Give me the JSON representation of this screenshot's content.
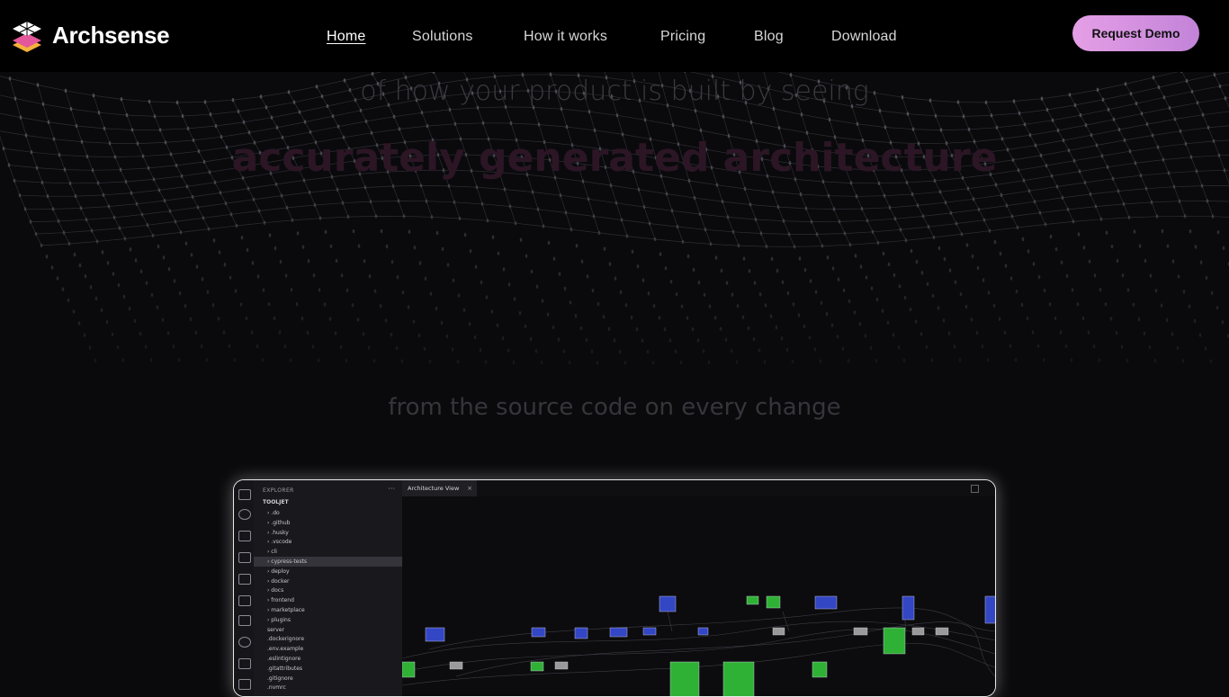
{
  "header": {
    "brand": "Archsense",
    "nav": [
      {
        "label": "Home",
        "active": true
      },
      {
        "label": "Solutions"
      },
      {
        "label": "How it works"
      },
      {
        "label": "Pricing"
      },
      {
        "label": "Blog"
      },
      {
        "label": "Download"
      }
    ],
    "cta_label": "Request Demo"
  },
  "hero": {
    "line1": "of how your product is built by seeing",
    "line2": "accurately generated architecture",
    "line3": "from the source code on every change"
  },
  "ide": {
    "explorer_title": "EXPLORER",
    "explorer_menu": "···",
    "root_folder": "TOOLJET",
    "tree": [
      ".do",
      ".github",
      ".husky",
      ".vscode",
      "cli",
      "cypress-tests",
      "deploy",
      "docker",
      "docs",
      "frontend",
      "marketplace",
      "plugins",
      "server",
      ".dockerignore",
      ".env.example",
      ".eslintignore",
      ".gitattributes",
      ".gitignore",
      ".nvmrc"
    ],
    "selected_item": "cypress-tests",
    "tab_label": "Architecture View",
    "tab_close": "×"
  },
  "colors": {
    "accent_start": "#e59fe6",
    "accent_end": "#c283d8",
    "node_blue": "#3346c4",
    "node_green": "#2fb136",
    "node_gray": "#9a9a9a"
  }
}
